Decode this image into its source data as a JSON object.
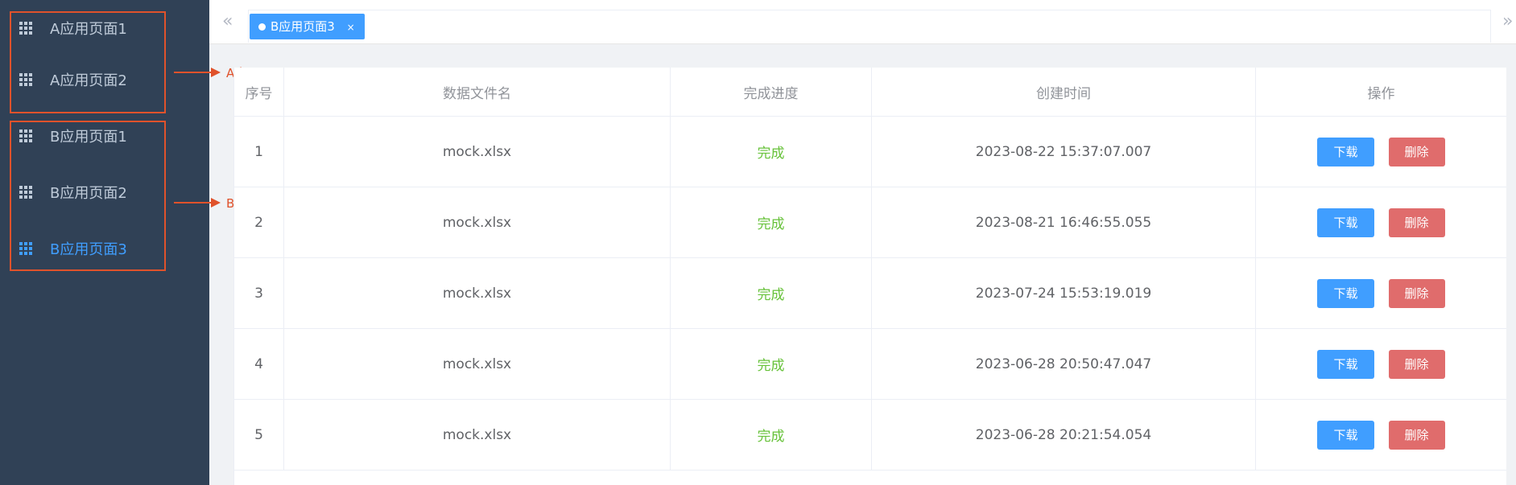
{
  "sidebar": {
    "items": [
      {
        "label": "A应用页面1",
        "active": false
      },
      {
        "label": "A应用页面2",
        "active": false
      },
      {
        "label": "B应用页面1",
        "active": false
      },
      {
        "label": "B应用页面2",
        "active": false
      },
      {
        "label": "B应用页面3",
        "active": true
      }
    ],
    "icon": "grid-icon"
  },
  "annotations": {
    "a_group": "A应用",
    "b_group": "B应用"
  },
  "tabs": {
    "prev_icon": "«",
    "next_icon": "»",
    "active_tab": {
      "label": "B应用页面3",
      "close": "×"
    }
  },
  "table": {
    "headers": [
      "序号",
      "数据文件名",
      "完成进度",
      "创建时间",
      "操作"
    ],
    "rows": [
      {
        "index": "1",
        "file": "mock.xlsx",
        "status": "完成",
        "created": "2023-08-22 15:37:07.007"
      },
      {
        "index": "2",
        "file": "mock.xlsx",
        "status": "完成",
        "created": "2023-08-21 16:46:55.055"
      },
      {
        "index": "3",
        "file": "mock.xlsx",
        "status": "完成",
        "created": "2023-07-24 15:53:19.019"
      },
      {
        "index": "4",
        "file": "mock.xlsx",
        "status": "完成",
        "created": "2023-06-28 20:50:47.047"
      },
      {
        "index": "5",
        "file": "mock.xlsx",
        "status": "完成",
        "created": "2023-06-28 20:21:54.054"
      }
    ],
    "actions": {
      "download": "下载",
      "delete": "删除"
    }
  },
  "colors": {
    "sidebar_bg": "#304156",
    "accent": "#409eff",
    "success": "#67c23a",
    "danger": "#e06c6c",
    "annotation": "#e0522b"
  }
}
